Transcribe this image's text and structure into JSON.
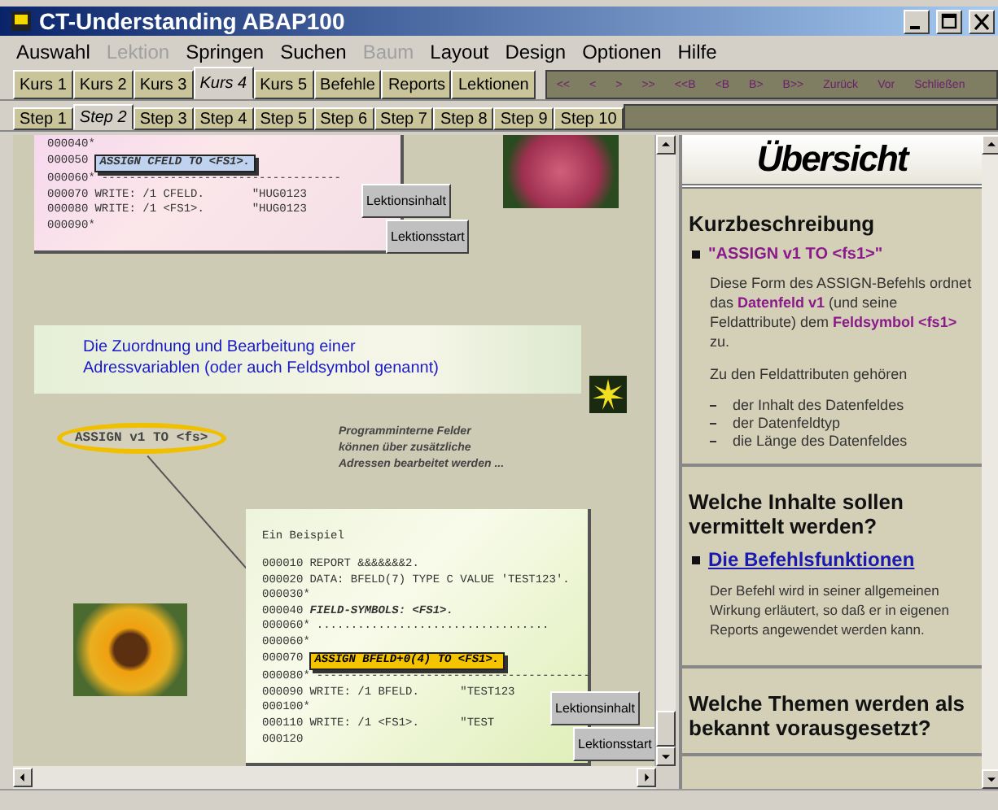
{
  "window": {
    "title": "CT-Understanding ABAP100"
  },
  "menu": [
    {
      "label": "Auswahl",
      "disabled": false
    },
    {
      "label": "Lektion",
      "disabled": true
    },
    {
      "label": "Springen",
      "disabled": false
    },
    {
      "label": "Suchen",
      "disabled": false
    },
    {
      "label": "Baum",
      "disabled": true
    },
    {
      "label": "Layout",
      "disabled": false
    },
    {
      "label": "Design",
      "disabled": false
    },
    {
      "label": "Optionen",
      "disabled": false
    },
    {
      "label": "Hilfe",
      "disabled": false
    }
  ],
  "course_tabs": [
    {
      "label": "Kurs 1",
      "selected": false
    },
    {
      "label": "Kurs 2",
      "selected": false
    },
    {
      "label": "Kurs 3",
      "selected": false
    },
    {
      "label": "Kurs 4",
      "selected": true
    },
    {
      "label": "Kurs 5",
      "selected": false
    },
    {
      "label": "Befehle",
      "selected": false
    },
    {
      "label": "Reports",
      "selected": false
    },
    {
      "label": "Lektionen",
      "selected": false
    }
  ],
  "nav_buttons": [
    "<<",
    "<",
    ">",
    ">>",
    "<<B",
    "<B",
    "B>",
    "B>>",
    "Zurück",
    "Vor",
    "Schließen"
  ],
  "step_tabs": [
    {
      "label": "Step 1",
      "selected": false
    },
    {
      "label": "Step 2",
      "selected": true
    },
    {
      "label": "Step 3",
      "selected": false
    },
    {
      "label": "Step 4",
      "selected": false
    },
    {
      "label": "Step 5",
      "selected": false
    },
    {
      "label": "Step 6",
      "selected": false
    },
    {
      "label": "Step 7",
      "selected": false
    },
    {
      "label": "Step 8",
      "selected": false
    },
    {
      "label": "Step 9",
      "selected": false
    },
    {
      "label": "Step 10",
      "selected": false
    }
  ],
  "slide": {
    "top_code": [
      {
        "number": "000040*"
      },
      {
        "number": "000050",
        "code": "ASSIGN CFELD TO <FS1>.",
        "kind": "box"
      },
      {
        "number": "000060*",
        "code": "-----------------------------------",
        "kind": "plain"
      },
      {
        "number": "000070",
        "code": "WRITE: /1 CFELD.       \"HUG0123",
        "kind": "plain"
      },
      {
        "number": "000080",
        "code": "WRITE: /1 <FS1>.       \"HUG0123",
        "kind": "plain"
      },
      {
        "number": "000090*"
      }
    ],
    "top_buttons": [
      "Lektionsinhalt",
      "Lektionsstart"
    ],
    "banner": "Die Zuordnung und Bearbeitung einer Adressvariablen (oder auch Feldsymbol genannt)",
    "callout": "ASSIGN v1 TO <fs>",
    "note": "Programminterne Felder können über zusätzliche Adressen bearbeitet werden ...",
    "example_title": "Ein Beispiel",
    "example_code": [
      {
        "number": "000010",
        "code": "REPORT &&&&&&&2.",
        "kind": "plain"
      },
      {
        "number": "000020",
        "code": "DATA: BFELD(7) TYPE C VALUE 'TEST123'.",
        "kind": "plain"
      },
      {
        "number": "000030*"
      },
      {
        "number": "000040",
        "code": "FIELD-SYMBOLS: <FS1>.",
        "kind": "bold"
      },
      {
        "number": "000060*",
        "code": "..................................",
        "kind": "plain"
      },
      {
        "number": "000060*"
      },
      {
        "number": "000070",
        "code": "ASSIGN BFELD+0(4) TO <FS1>.",
        "kind": "highlight"
      },
      {
        "number": "000080*",
        "code": "----------------------------------------",
        "kind": "plain"
      },
      {
        "number": "000090",
        "code": "WRITE: /1 BFELD.      \"TEST123",
        "kind": "plain"
      },
      {
        "number": "000100*"
      },
      {
        "number": "000110",
        "code": "WRITE: /1 <FS1>.      \"TEST",
        "kind": "plain"
      },
      {
        "number": "000120"
      }
    ],
    "bottom_buttons": [
      "Lektionsinhalt",
      "Lektionsstart"
    ]
  },
  "overview": {
    "heading": "Übersicht",
    "sections": [
      {
        "title": "Kurzbeschreibung",
        "bullet": "\"ASSIGN v1 TO <fs1>\"",
        "kind": "quote",
        "paragraphs": [
          "Diese Form des ASSIGN-Befehls ordnet das **Datenfeld v1** (und seine Feldattribute) dem **Feldsymbol <fs1>** zu.",
          "Zu den Feldattributen gehören"
        ],
        "list": [
          "der Inhalt des Datenfeldes",
          "der Datenfeldtyp",
          "die Länge des Datenfeldes"
        ]
      },
      {
        "title": "Welche Inhalte sollen vermittelt werden?",
        "bullet": "Die Befehlsfunktionen",
        "kind": "link",
        "paragraphs": [
          "Der Befehl wird in seiner allgemeinen Wirkung erläutert, so daß er in eigenen Reports angewendet werden kann."
        ]
      },
      {
        "title": "Welche Themen werden als bekannt vorausgesetzt?"
      }
    ]
  }
}
